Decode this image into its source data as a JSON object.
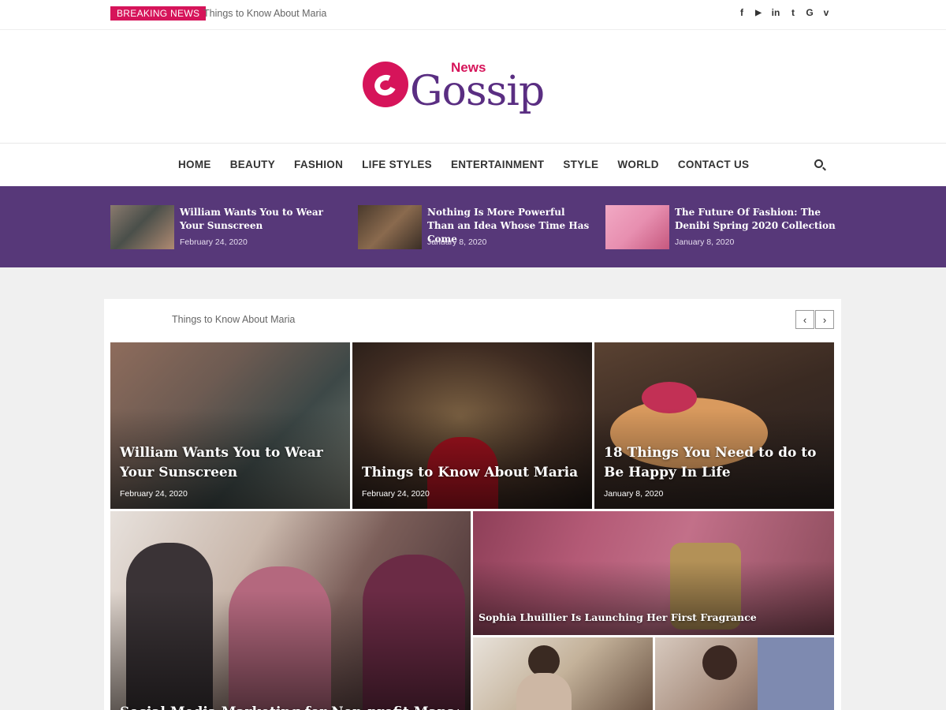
{
  "topbar": {
    "breaking_label": "BREAKING NEWS",
    "breaking_text": "Things to Know About Maria",
    "socials": [
      {
        "icon": "facebook-icon",
        "glyph": "f"
      },
      {
        "icon": "youtube-icon",
        "glyph": "▶"
      },
      {
        "icon": "linkedin-icon",
        "glyph": "in"
      },
      {
        "icon": "twitter-icon",
        "glyph": "t"
      },
      {
        "icon": "google-icon",
        "glyph": "G"
      },
      {
        "icon": "vimeo-icon",
        "glyph": "v"
      }
    ]
  },
  "logo": {
    "news": "News",
    "gossip": "Gossip"
  },
  "nav": {
    "items": [
      "HOME",
      "BEAUTY",
      "FASHION",
      "LIFE STYLES",
      "ENTERTAINMENT",
      "STYLE",
      "WORLD",
      "CONTACT US"
    ],
    "search_icon": "search-icon"
  },
  "band": [
    {
      "title": "William Wants You to Wear Your Sunscreen",
      "date": "February 24, 2020"
    },
    {
      "title": "Nothing Is More Powerful Than an Idea Whose Time Has Come",
      "date": "January 8, 2020"
    },
    {
      "title": "The Future Of Fashion: The Denibi Spring 2020 Collection",
      "date": "January 8, 2020"
    }
  ],
  "main": {
    "label": "Things to Know About Maria",
    "prev_icon": "chevron-left-icon",
    "next_icon": "chevron-right-icon",
    "prev_glyph": "‹",
    "next_glyph": "›",
    "tiles": [
      {
        "title": "William Wants You to Wear Your Sunscreen",
        "date": "February 24, 2020"
      },
      {
        "title": "Things to Know About Maria",
        "date": "February 24, 2020"
      },
      {
        "title": "18 Things You Need to do to Be Happy In Life",
        "date": "January 8, 2020"
      },
      {
        "title": "Social Media Marketing for Non-profit Management"
      },
      {
        "title": "Sophia Lhuillier Is Launching Her First Fragrance"
      }
    ]
  },
  "colors": {
    "accent": "#d6145a",
    "brand_purple": "#573879"
  }
}
